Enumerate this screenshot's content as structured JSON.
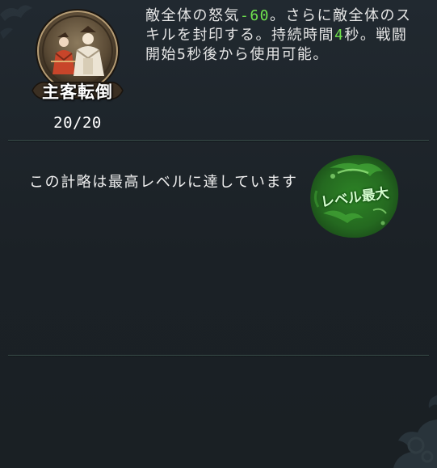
{
  "skill": {
    "name": "主客転倒",
    "count": "20/20",
    "icon": "samurai-pair-icon"
  },
  "description": {
    "p1": "敵全体の怒気",
    "v1": "-60",
    "p2": "。さらに敵全体のスキルを封印する。持続時間",
    "v2": "4",
    "p3": "秒。戦闘開始5秒後から使用可能。"
  },
  "status": {
    "max_message": "この計略は最高レベルに達しています",
    "stamp_label": "レベル最大"
  },
  "colors": {
    "highlight": "#6fe24e",
    "stamp": "#2f9a2a",
    "background": "#1c2227"
  }
}
